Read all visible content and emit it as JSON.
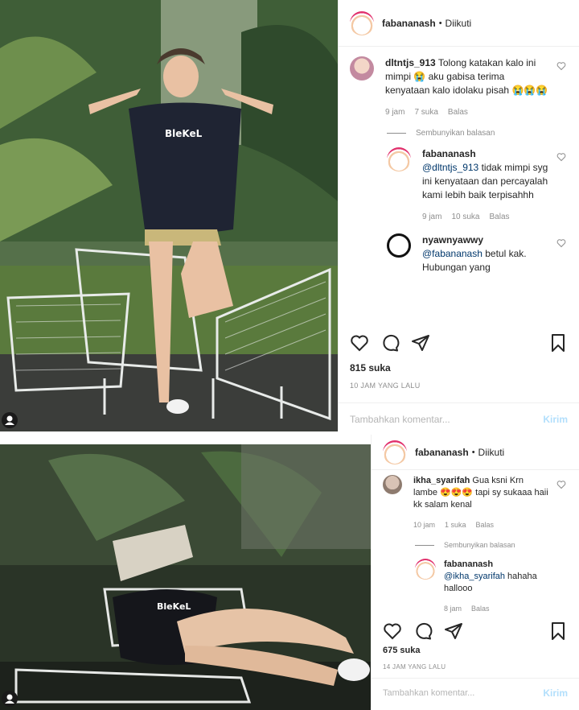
{
  "post1": {
    "username": "fabananash",
    "following": "Diikuti",
    "comments": [
      {
        "user": "dltntjs_913",
        "text": "Tolong katakan kalo ini mimpi 😭 aku gabisa terima kenyataan kalo idolaku pisah 😭😭😭",
        "time": "9 jam",
        "likes": "7 suka",
        "reply": "Balas"
      },
      {
        "user": "fabananash",
        "mention": "@dltntjs_913",
        "text": "tidak mimpi syg ini kenyataan dan percayalah kami lebih baik terpisahhh",
        "time": "9 jam",
        "likes": "10 suka",
        "reply": "Balas"
      },
      {
        "user": "nyawnyawwy",
        "mention": "@fabananash",
        "text": "betul kak. Hubungan yang"
      }
    ],
    "hide_replies": "Sembunyikan balasan",
    "likes": "815 suka",
    "ago": "10 JAM YANG LALU",
    "add_comment": "Tambahkan komentar...",
    "post_button": "Kirim"
  },
  "post2": {
    "username": "fabananash",
    "following": "Diikuti",
    "comments": [
      {
        "user": "ikha_syarifah",
        "text": "Gua ksni Krn lambe 😍😍😍 tapi sy sukaaa haii kk salam kenal",
        "time": "10 jam",
        "likes": "1 suka",
        "reply": "Balas"
      },
      {
        "user": "fabananash",
        "mention": "@ikha_syarifah",
        "text": "hahaha hallooo",
        "time": "8 jam",
        "reply": "Balas"
      }
    ],
    "hide_replies": "Sembunyikan balasan",
    "likes": "675 suka",
    "ago": "14 JAM YANG LALU",
    "add_comment": "Tambahkan komentar...",
    "post_button": "Kirim"
  },
  "icons": [
    "heart-icon",
    "comment-icon",
    "share-icon",
    "bookmark-icon",
    "tag-user-icon"
  ],
  "colors": {
    "accent_link": "#00376b",
    "muted": "#8e8e8e",
    "post_button": "#b2dffc"
  }
}
